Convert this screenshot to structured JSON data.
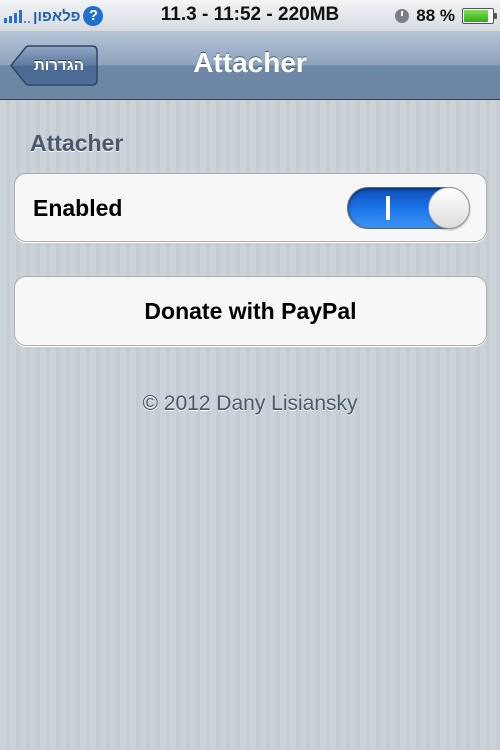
{
  "status_bar": {
    "carrier": "פלאפון",
    "center_text": "11.3 - 11:52 - 220MB",
    "battery_percent": "88 %",
    "battery_level": 0.88,
    "icons": [
      "signal-bars-icon",
      "carrier-logo-icon",
      "clock-icon",
      "battery-icon"
    ]
  },
  "nav": {
    "title": "Attacher",
    "back_label": "הגדרות"
  },
  "content": {
    "section_header": "Attacher",
    "enabled_label": "Enabled",
    "enabled_value": true,
    "donate_label": "Donate with PayPal",
    "footer": "© 2012 Dany Lisiansky"
  },
  "colors": {
    "switch_on": "#1a73e8",
    "nav_bar": "#6d87a6",
    "background": "#c5ccd4"
  }
}
